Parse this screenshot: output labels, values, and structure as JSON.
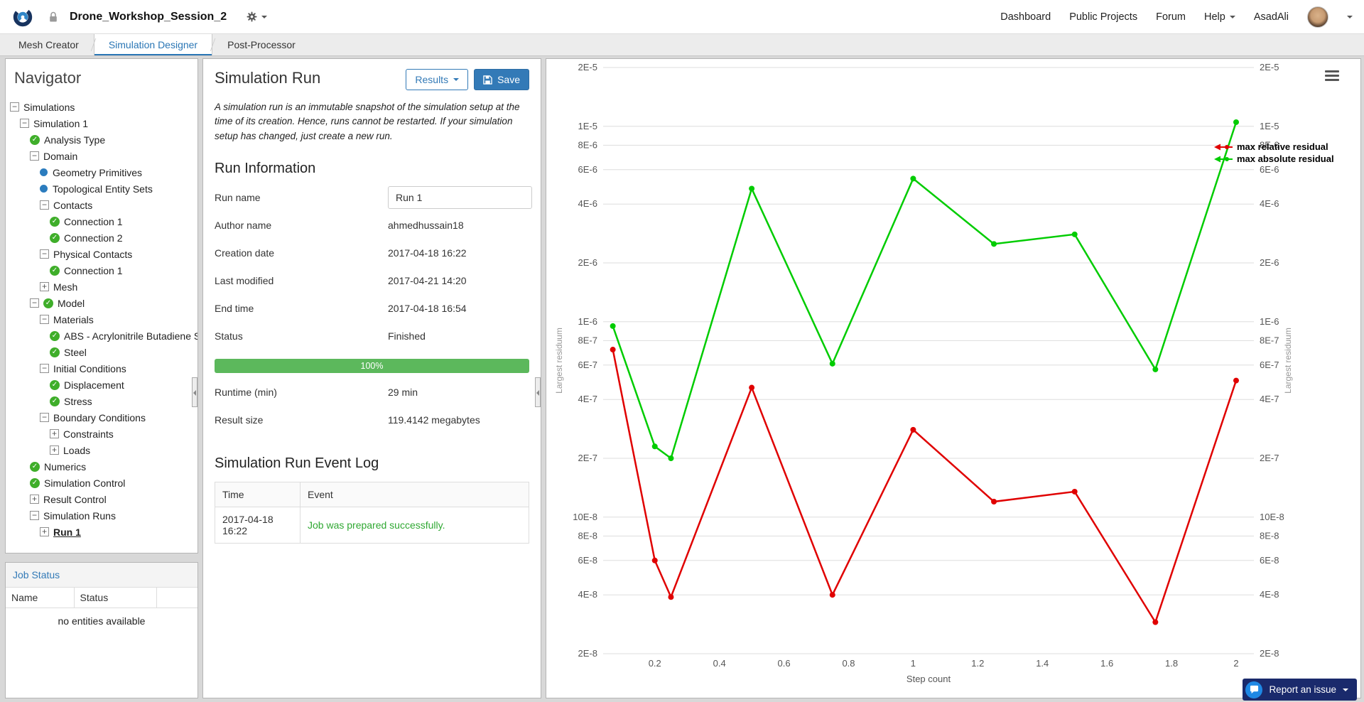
{
  "header": {
    "project_title": "Drone_Workshop_Session_2",
    "nav": [
      "Dashboard",
      "Public Projects",
      "Forum",
      "Help"
    ],
    "username": "AsadAli"
  },
  "tabs": [
    {
      "label": "Mesh Creator",
      "active": false
    },
    {
      "label": "Simulation Designer",
      "active": true
    },
    {
      "label": "Post-Processor",
      "active": false
    }
  ],
  "navigator": {
    "title": "Navigator",
    "tree": [
      {
        "label": "Simulations",
        "level": 0,
        "icon": "collapse"
      },
      {
        "label": "Simulation 1",
        "level": 1,
        "icon": "collapse"
      },
      {
        "label": "Analysis Type",
        "level": 2,
        "icon": "check"
      },
      {
        "label": "Domain",
        "level": 2,
        "icon": "collapse"
      },
      {
        "label": "Geometry Primitives",
        "level": 3,
        "icon": "dot"
      },
      {
        "label": "Topological Entity Sets",
        "level": 3,
        "icon": "dot"
      },
      {
        "label": "Contacts",
        "level": 3,
        "icon": "collapse"
      },
      {
        "label": "Connection 1",
        "level": 4,
        "icon": "check"
      },
      {
        "label": "Connection 2",
        "level": 4,
        "icon": "check"
      },
      {
        "label": "Physical Contacts",
        "level": 3,
        "icon": "collapse"
      },
      {
        "label": "Connection 1",
        "level": 4,
        "icon": "check"
      },
      {
        "label": "Mesh",
        "level": 3,
        "icon": "expand"
      },
      {
        "label": "Model",
        "level": 2,
        "icon": "collapse",
        "check": true
      },
      {
        "label": "Materials",
        "level": 3,
        "icon": "collapse"
      },
      {
        "label": "ABS - Acrylonitrile Butadiene St...",
        "level": 4,
        "icon": "check"
      },
      {
        "label": "Steel",
        "level": 4,
        "icon": "check"
      },
      {
        "label": "Initial Conditions",
        "level": 3,
        "icon": "collapse"
      },
      {
        "label": "Displacement",
        "level": 4,
        "icon": "check"
      },
      {
        "label": "Stress",
        "level": 4,
        "icon": "check"
      },
      {
        "label": "Boundary Conditions",
        "level": 3,
        "icon": "collapse"
      },
      {
        "label": "Constraints",
        "level": 4,
        "icon": "expand"
      },
      {
        "label": "Loads",
        "level": 4,
        "icon": "expand"
      },
      {
        "label": "Numerics",
        "level": 2,
        "icon": "check"
      },
      {
        "label": "Simulation Control",
        "level": 2,
        "icon": "check"
      },
      {
        "label": "Result Control",
        "level": 2,
        "icon": "expand"
      },
      {
        "label": "Simulation Runs",
        "level": 2,
        "icon": "collapse"
      },
      {
        "label": "Run 1",
        "level": 3,
        "icon": "expand",
        "bold": true
      }
    ]
  },
  "job_status": {
    "title": "Job Status",
    "columns": [
      "Name",
      "Status"
    ],
    "empty_message": "no entities available"
  },
  "run_panel": {
    "title": "Simulation Run",
    "results_button": "Results",
    "save_button": "Save",
    "note": "A simulation run is an immutable snapshot of the simulation setup at the time of its creation. Hence, runs cannot be restarted. If your simulation setup has changed, just create a new run.",
    "run_info": {
      "heading": "Run Information",
      "fields": [
        {
          "label": "Run name",
          "value": "Run 1",
          "type": "input"
        },
        {
          "label": "Author name",
          "value": "ahmedhussain18"
        },
        {
          "label": "Creation date",
          "value": "2017-04-18 16:22"
        },
        {
          "label": "Last modified",
          "value": "2017-04-21 14:20"
        },
        {
          "label": "End time",
          "value": "2017-04-18 16:54"
        },
        {
          "label": "Status",
          "value": "Finished"
        }
      ],
      "progress": {
        "percent": "100%",
        "value": 100
      },
      "fields_after": [
        {
          "label": "Runtime (min)",
          "value": "29 min"
        },
        {
          "label": "Result size",
          "value": "119.4142 megabytes"
        }
      ]
    },
    "event_log": {
      "heading": "Simulation Run Event Log",
      "columns": [
        "Time",
        "Event"
      ],
      "rows": [
        {
          "time": "2017-04-18 16:22",
          "event": "Job was prepared successfully."
        }
      ]
    }
  },
  "chart_data": {
    "type": "line",
    "xlabel": "Step count",
    "ylabel_left": "Largest residuum",
    "ylabel_right": "Largest residuum",
    "y_scale": "log",
    "grid": "horizontal",
    "legend_position": "top-right",
    "x_range": [
      0.04,
      2.055
    ],
    "y_range": [
      2e-08,
      2e-05
    ],
    "x_ticks": [
      0.2,
      0.4,
      0.6,
      0.8,
      1,
      1.2,
      1.4,
      1.6,
      1.8,
      2
    ],
    "y_ticks": [
      {
        "label": "2E-5",
        "value": 2e-05
      },
      {
        "label": "1E-5",
        "value": 1e-05
      },
      {
        "label": "8E-6",
        "value": 8e-06
      },
      {
        "label": "6E-6",
        "value": 6e-06
      },
      {
        "label": "4E-6",
        "value": 4e-06
      },
      {
        "label": "2E-6",
        "value": 2e-06
      },
      {
        "label": "1E-6",
        "value": 1e-06
      },
      {
        "label": "8E-7",
        "value": 8e-07
      },
      {
        "label": "6E-7",
        "value": 6e-07
      },
      {
        "label": "4E-7",
        "value": 4e-07
      },
      {
        "label": "2E-7",
        "value": 2e-07
      },
      {
        "label": "10E-8",
        "value": 1e-07
      },
      {
        "label": "8E-8",
        "value": 8e-08
      },
      {
        "label": "6E-8",
        "value": 6e-08
      },
      {
        "label": "4E-8",
        "value": 4e-08
      },
      {
        "label": "2E-8",
        "value": 2e-08
      }
    ],
    "x": [
      0.07,
      0.2,
      0.25,
      0.5,
      0.75,
      1,
      1.25,
      1.5,
      1.75,
      2
    ],
    "series": [
      {
        "name": "max relative residual",
        "color": "#e00000",
        "values": [
          7.2e-07,
          6e-08,
          3.9e-08,
          4.6e-07,
          4e-08,
          2.8e-07,
          1.2e-07,
          1.35e-07,
          2.9e-08,
          5e-07
        ]
      },
      {
        "name": "max absolute residual",
        "color": "#00cc00",
        "values": [
          9.5e-07,
          2.3e-07,
          2e-07,
          4.8e-06,
          6.1e-07,
          5.4e-06,
          2.5e-06,
          2.8e-06,
          5.7e-07,
          1.05e-05
        ]
      }
    ]
  },
  "report_issue": {
    "label": "Report an issue"
  },
  "colors": {
    "accent_blue": "#337ab7",
    "progress_green": "#5cb85c",
    "event_success_green": "#2fa832",
    "series_red": "#e00000",
    "series_green": "#00cc00"
  }
}
